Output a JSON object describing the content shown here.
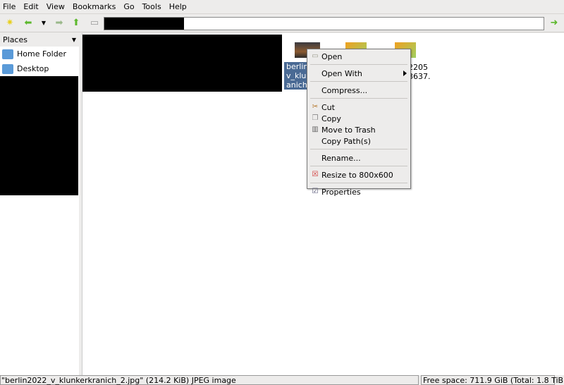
{
  "menubar": [
    "File",
    "Edit",
    "View",
    "Bookmarks",
    "Go",
    "Tools",
    "Help"
  ],
  "toolbar": {
    "icons": [
      "new-tab-icon",
      "back-icon",
      "history-dropdown-icon",
      "forward-icon",
      "up-icon",
      "home-folder-icon",
      "go-icon"
    ],
    "address_value": ""
  },
  "sidebar": {
    "header": "Places",
    "items": [
      {
        "label": "Home Folder",
        "icon": "home-folder-icon"
      },
      {
        "label": "Desktop",
        "icon": "desktop-folder-icon"
      }
    ]
  },
  "files": [
    {
      "label_lines": [
        "berlin",
        "v_klun",
        "anich"
      ],
      "selected": true
    },
    {
      "label_lines": [],
      "selected": false
    },
    {
      "label_lines": [
        "2205",
        "3637.",
        "."
      ],
      "selected": false
    }
  ],
  "context_menu": {
    "items": [
      {
        "label": "Open",
        "icon": "folder-open-icon"
      },
      {
        "label": "Open With",
        "submenu": true
      },
      {
        "separator": true
      },
      {
        "label": "Compress..."
      },
      {
        "separator": true
      },
      {
        "label": "Cut",
        "icon": "scissors-icon"
      },
      {
        "label": "Copy",
        "icon": "copy-icon"
      },
      {
        "label": "Move to Trash",
        "icon": "trash-icon"
      },
      {
        "label": "Copy Path(s)"
      },
      {
        "label": "Rename..."
      },
      {
        "label": "Resize to 800x600",
        "icon": "image-resize-icon"
      },
      {
        "label": "Properties",
        "icon": "properties-icon"
      }
    ]
  },
  "status": {
    "left": "\"berlin2022_v_klunkerkranich_2.jpg\" (214.2 KiB) JPEG image",
    "right": "Free space: 711.9 GiB (Total: 1.8 TiB)"
  },
  "colors": {
    "selection": "#4a6a94",
    "folder": "#5a9ad8"
  }
}
